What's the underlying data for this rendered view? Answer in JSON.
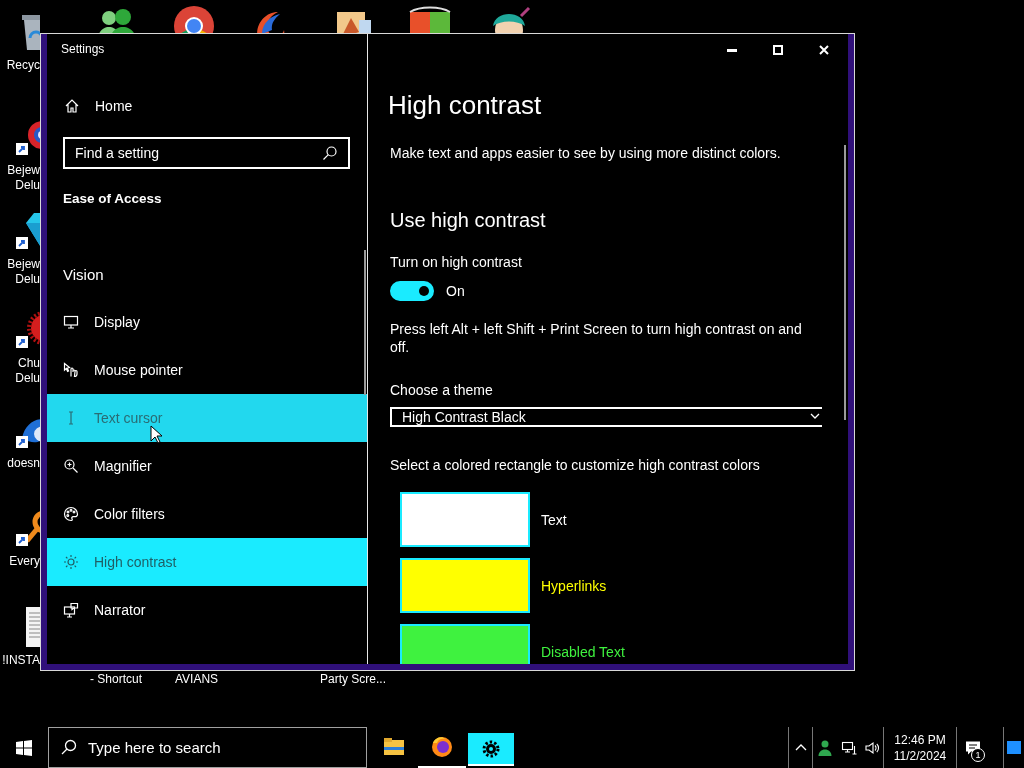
{
  "desktop": {
    "icons": [
      {
        "kind": "recycle",
        "label": "Recyc"
      },
      {
        "kind": "ruby",
        "label": "Bejew Delu"
      },
      {
        "kind": "diamond",
        "label": "Bejew Delu"
      },
      {
        "kind": "fuzzball",
        "label": "Chu Delu"
      },
      {
        "kind": "bird",
        "label": "doesn"
      },
      {
        "kind": "magnifier",
        "label": "Every"
      },
      {
        "kind": "document",
        "label": "!INSTA"
      }
    ],
    "hidden_icon_labels": [
      "- Shortcut",
      "AVIANS",
      "Party Scre..."
    ]
  },
  "window": {
    "title": "Settings"
  },
  "sidebar": {
    "home": "Home",
    "search": {
      "placeholder": "Find a setting"
    },
    "category": "Ease of Access",
    "group": "Vision",
    "items": [
      {
        "kind": "display",
        "label": "Display",
        "selected": false,
        "hovered": false
      },
      {
        "kind": "pointer",
        "label": "Mouse pointer",
        "selected": false,
        "hovered": false
      },
      {
        "kind": "cursor",
        "label": "Text cursor",
        "selected": false,
        "hovered": true
      },
      {
        "kind": "magnifier",
        "label": "Magnifier",
        "selected": false,
        "hovered": false
      },
      {
        "kind": "filters",
        "label": "Color filters",
        "selected": false,
        "hovered": false
      },
      {
        "kind": "contrast",
        "label": "High contrast",
        "selected": true,
        "hovered": false
      },
      {
        "kind": "narrator",
        "label": "Narrator",
        "selected": false,
        "hovered": false
      }
    ]
  },
  "content": {
    "title": "High contrast",
    "description": "Make text and apps easier to see by using more distinct colors.",
    "section": "Use high contrast",
    "toggle": {
      "label": "Turn on high contrast",
      "on": true,
      "state_text": "On"
    },
    "hint": "Press left Alt + left Shift + Print Screen to turn high contrast on and off.",
    "theme": {
      "label": "Choose a theme",
      "value": "High Contrast Black"
    },
    "colors": {
      "label": "Select a colored rectangle to customize high contrast colors",
      "swatches": [
        {
          "label": "Text",
          "color": "#ffffff"
        },
        {
          "label": "Hyperlinks",
          "color": "#ffff00"
        },
        {
          "label": "Disabled Text",
          "color": "#3ff23f"
        }
      ]
    }
  },
  "taskbar": {
    "search": {
      "placeholder": "Type here to search"
    },
    "apps": [
      {
        "kind": "explorer",
        "running": false,
        "active": false
      },
      {
        "kind": "firefox",
        "running": true,
        "active": false
      },
      {
        "kind": "settings",
        "running": true,
        "active": true
      }
    ],
    "time": "12:46 PM",
    "date": "11/2/2024",
    "notifications": "1"
  }
}
